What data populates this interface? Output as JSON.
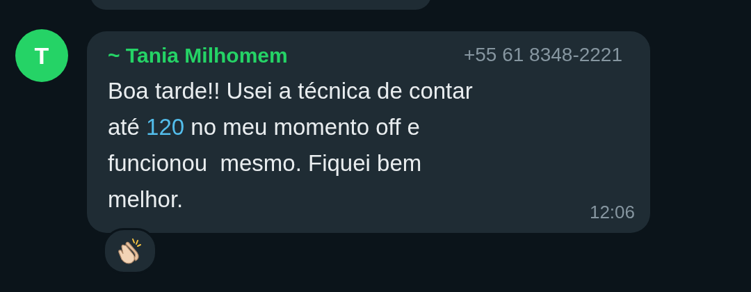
{
  "message": {
    "avatar_initial": "T",
    "sender": "~ Tania Milhomem",
    "phone": "+55 61 8348-2221",
    "lines": [
      [
        {
          "kind": "text",
          "text": "Boa tarde!! Usei a técnica de contar"
        }
      ],
      [
        {
          "kind": "text",
          "text": "até "
        },
        {
          "kind": "number",
          "text": "120"
        },
        {
          "kind": "text",
          "text": " no meu momento off e"
        }
      ],
      [
        {
          "kind": "text",
          "text": "funcionou  mesmo. Fiquei bem"
        }
      ],
      [
        {
          "kind": "text",
          "text": "melhor."
        }
      ]
    ],
    "time": "12:06"
  }
}
